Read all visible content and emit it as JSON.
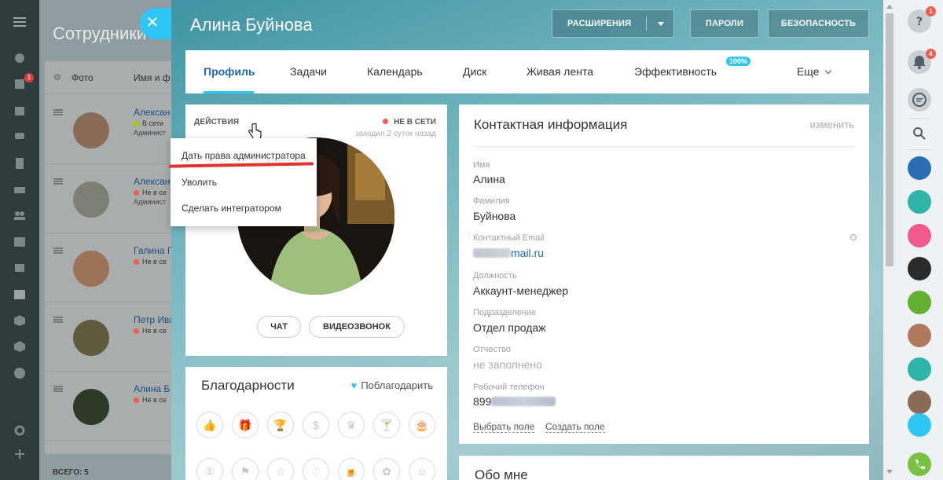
{
  "background": {
    "title": "Сотрудники",
    "table_headers": {
      "photo": "Фото",
      "name": "Имя и ф"
    },
    "rows": [
      {
        "name": "Алексан",
        "status": "В сети",
        "status_color": "#9dcf00",
        "role": "Админист"
      },
      {
        "name": "Алексан",
        "status": "Не в се",
        "status_color": "#f05d4e",
        "role": "Админист"
      },
      {
        "name": "Галина Г",
        "status": "Не в се",
        "status_color": "#f05d4e",
        "role": ""
      },
      {
        "name": "Петр Ива",
        "status": "Не в се",
        "status_color": "#f05d4e",
        "role": ""
      },
      {
        "name": "Алина Б",
        "status": "Не в се",
        "status_color": "#f05d4e",
        "role": ""
      }
    ],
    "total": "ВСЕГО: 5",
    "left_badge": "1"
  },
  "panel": {
    "title": "Алина Буйнова",
    "toolbar": {
      "extensions": "РАСШИРЕНИЯ",
      "passwords": "ПАРОЛИ",
      "security": "БЕЗОПАСНОСТЬ"
    },
    "tabs": [
      {
        "label": "Профиль",
        "active": true
      },
      {
        "label": "Задачи"
      },
      {
        "label": "Календарь"
      },
      {
        "label": "Диск"
      },
      {
        "label": "Живая лента"
      },
      {
        "label": "Эффективность",
        "badge": "100%"
      },
      {
        "label": "Еще"
      }
    ]
  },
  "profile": {
    "actions_label": "ДЕЙСТВИЯ",
    "status": "НЕ В СЕТИ",
    "last_seen": "заходил 2 суток назад",
    "chat_button": "ЧАТ",
    "video_button": "ВИДЕОЗВОНОК",
    "menu": [
      "Дать права администратора",
      "Уволить",
      "Сделать интегратором"
    ]
  },
  "thanks": {
    "title": "Благодарности",
    "thank_link": "Поблагодарить",
    "badges": [
      "thumb-up-icon",
      "gift-icon",
      "cup-icon",
      "money-bag-icon",
      "crown-icon",
      "cocktail-icon",
      "cake-icon",
      "number-one-icon",
      "flag-icon",
      "star-icon",
      "heart-icon",
      "beer-icon",
      "flower-icon",
      "smile-icon"
    ]
  },
  "contact": {
    "title": "Контактная информация",
    "edit": "изменить",
    "fields": [
      {
        "label": "Имя",
        "value": "Алина"
      },
      {
        "label": "Фамилия",
        "value": "Буйнова"
      },
      {
        "label": "Контактный Email",
        "value": "mail.ru"
      },
      {
        "label": "Должность",
        "value": "Аккаунт-менеджер"
      },
      {
        "label": "Подразделение",
        "value": "Отдел продаж"
      },
      {
        "label": "Отчество",
        "value": "не заполнено"
      },
      {
        "label": "Рабочий телефон",
        "value": "899"
      }
    ],
    "choose_field": "Выбрать поле",
    "create_field": "Создать поле"
  },
  "about": {
    "title": "Обо мне"
  },
  "rightbar": {
    "help_badge": "1",
    "notify_badge": "4"
  }
}
